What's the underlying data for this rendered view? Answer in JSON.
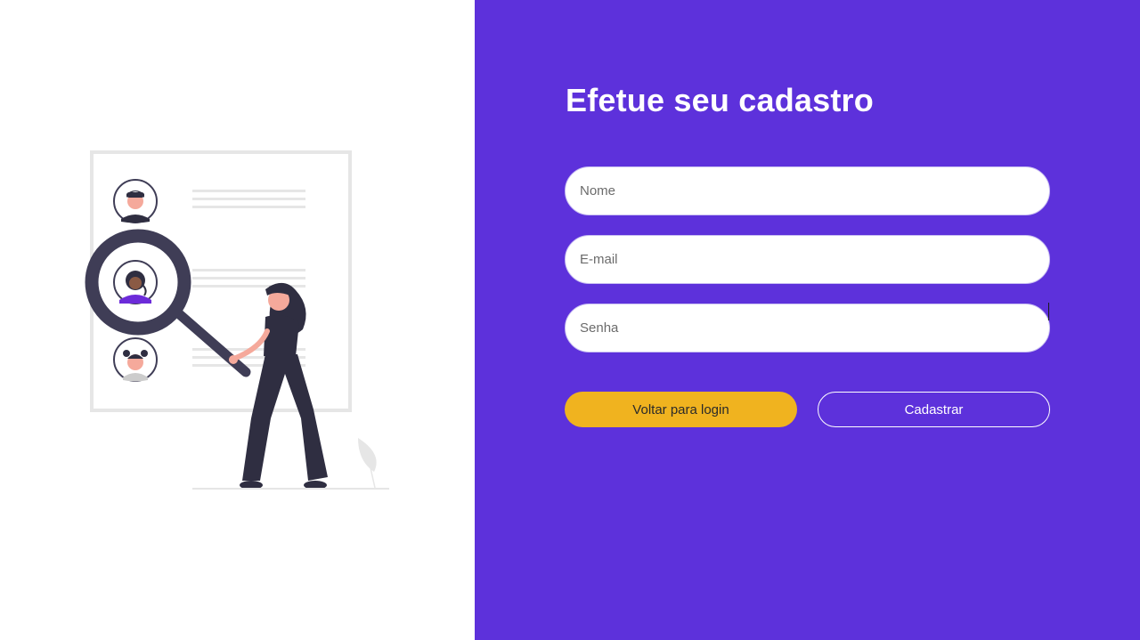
{
  "form": {
    "title": "Efetue seu cadastro",
    "fields": {
      "name_placeholder": "Nome",
      "email_placeholder": "E-mail",
      "password_placeholder": "Senha"
    },
    "buttons": {
      "back_label": "Voltar para login",
      "submit_label": "Cadastrar"
    }
  },
  "colors": {
    "panel_background": "#5d31db",
    "back_button": "#f0b31f",
    "submit_button_border": "#ffffff",
    "illustration_dark": "#3f3d56",
    "illustration_accent": "#6c2bd9",
    "illustration_skin": "#f5a99b"
  },
  "illustration": {
    "icon_name": "profile-search-illustration"
  }
}
